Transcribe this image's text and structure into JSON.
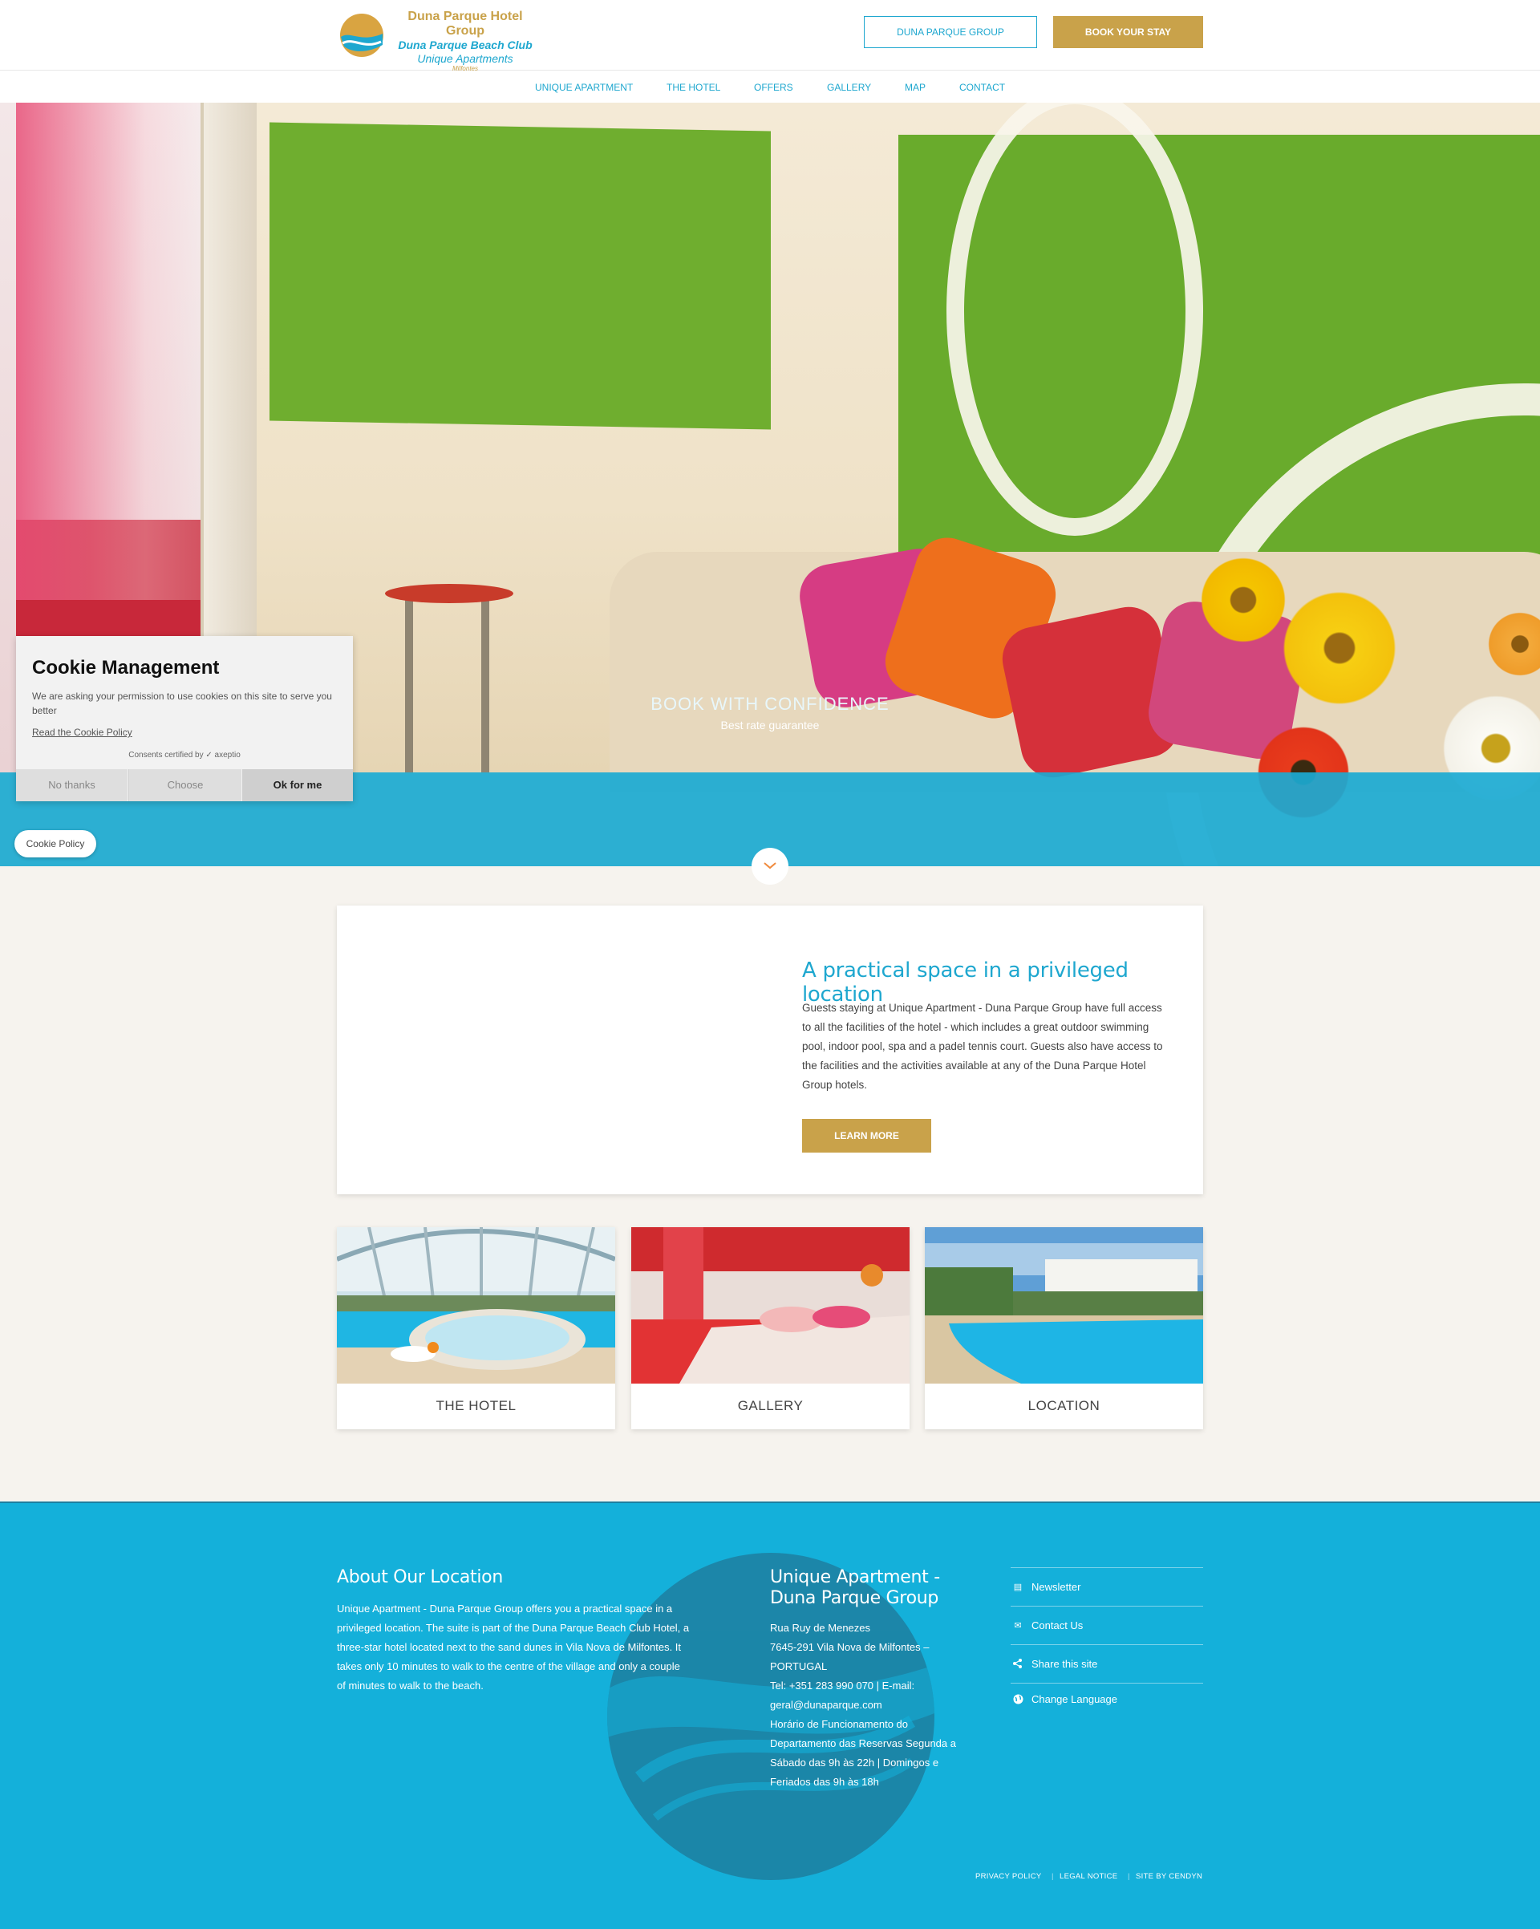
{
  "header": {
    "logo": {
      "line1": "Duna Parque Hotel Group",
      "line2": "Duna Parque Beach Club",
      "line3": "Unique Apartments",
      "line4": "Milfontes",
      "stars": "★★★"
    },
    "group_button": "DUNA PARQUE GROUP",
    "book_button": "BOOK YOUR STAY"
  },
  "nav": {
    "items": [
      {
        "label": "UNIQUE APARTMENT"
      },
      {
        "label": "THE HOTEL"
      },
      {
        "label": "OFFERS"
      },
      {
        "label": "GALLERY"
      },
      {
        "label": "MAP"
      },
      {
        "label": "CONTACT"
      }
    ]
  },
  "hero": {
    "banner_title": "BOOK WITH CONFIDENCE",
    "banner_subtitle": "Best rate guarantee",
    "down_icon": "chevron-down-icon"
  },
  "cookie": {
    "title": "Cookie Management",
    "text": "We are asking your permission to use cookies on this site to serve you better",
    "policy_link": "Read the Cookie Policy",
    "certified": "Consents certified by ✓ axeptio",
    "buttons": {
      "no": "No thanks",
      "choose": "Choose",
      "ok": "Ok for me"
    },
    "policy_pill": "Cookie Policy"
  },
  "intro": {
    "title": "A practical space in a privileged location",
    "text": "Guests staying at Unique Apartment - Duna Parque Group have full access to all the facilities of the hotel - which includes a great outdoor swimming pool, indoor pool, spa and a padel tennis court. Guests also have access to the facilities and the activities available at any of the Duna Parque Hotel Group hotels.",
    "button": "LEARN MORE"
  },
  "tiles": [
    {
      "label": "THE HOTEL"
    },
    {
      "label": "GALLERY"
    },
    {
      "label": "LOCATION"
    }
  ],
  "footer": {
    "about_title": "About Our Location",
    "about_text": "Unique Apartment - Duna Parque Group offers you a practical space in a privileged location. The suite is part of the Duna Parque Beach Club Hotel, a three-star hotel located next to the sand dunes in Vila Nova de Milfontes. It takes only 10 minutes to walk to the centre of the village and only a couple of minutes to walk to the beach.",
    "contact_title_1": "Unique Apartment -",
    "contact_title_2": "Duna Parque Group",
    "address": [
      "Rua Ruy de Menezes",
      "7645-291 Vila Nova de Milfontes –",
      "PORTUGAL",
      "Tel: +351 283 990 070 | E-mail:",
      "geral@dunaparque.com",
      "Horário de Funcionamento do",
      "Departamento das Reservas Segunda a",
      "Sábado das 9h às 22h | Domingos e",
      "Feriados das 9h às 18h"
    ],
    "links": [
      {
        "label": "Newsletter",
        "icon": "newsletter-icon"
      },
      {
        "label": "Contact Us",
        "icon": "envelope-icon"
      },
      {
        "label": "Share this site",
        "icon": "share-icon"
      },
      {
        "label": "Change Language",
        "icon": "globe-icon"
      }
    ],
    "legal": {
      "privacy": "PRIVACY POLICY",
      "notice": "LEGAL NOTICE",
      "site": "SITE BY CENDYN"
    }
  },
  "colors": {
    "accent_blue": "#1ea7cf",
    "gold": "#c9a24a",
    "footer_blue": "#14b0da"
  }
}
